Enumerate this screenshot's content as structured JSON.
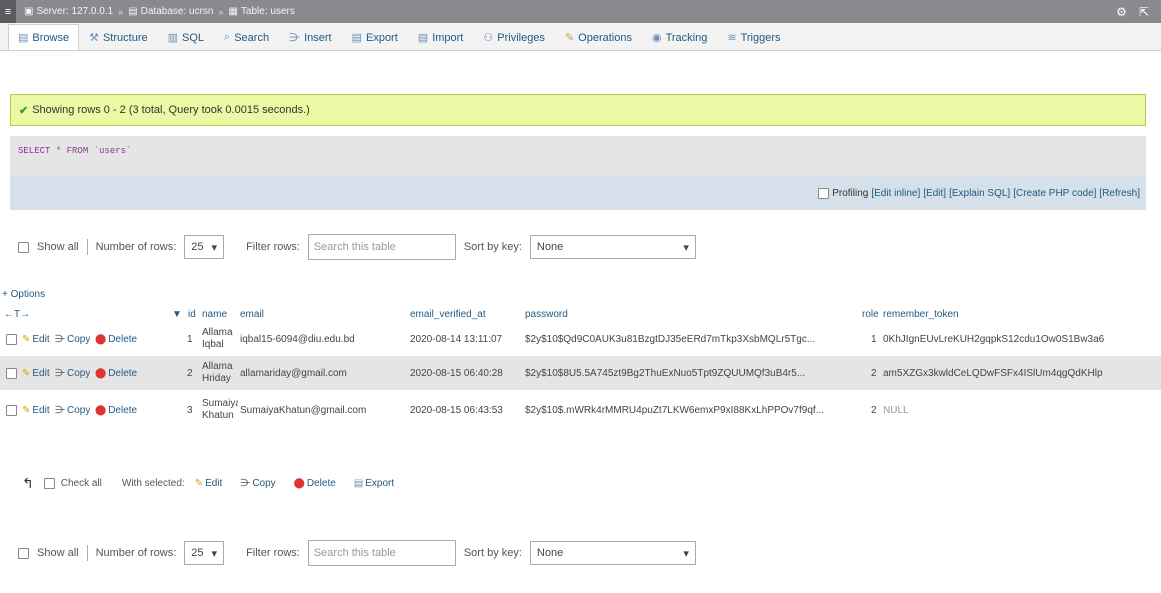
{
  "breadcrumb": {
    "server": "Server: 127.0.0.1",
    "database": "Database: ucrsn",
    "table": "Table: users"
  },
  "tabs": [
    {
      "label": "Browse",
      "icon": "browse-icon"
    },
    {
      "label": "Structure",
      "icon": "structure-icon"
    },
    {
      "label": "SQL",
      "icon": "sql-icon"
    },
    {
      "label": "Search",
      "icon": "search-icon"
    },
    {
      "label": "Insert",
      "icon": "insert-icon"
    },
    {
      "label": "Export",
      "icon": "export-icon"
    },
    {
      "label": "Import",
      "icon": "import-icon"
    },
    {
      "label": "Privileges",
      "icon": "privileges-icon"
    },
    {
      "label": "Operations",
      "icon": "operations-icon"
    },
    {
      "label": "Tracking",
      "icon": "tracking-icon"
    },
    {
      "label": "Triggers",
      "icon": "triggers-icon"
    }
  ],
  "message": "Showing rows 0 - 2 (3 total, Query took 0.0015 seconds.)",
  "sql": {
    "select": "SELECT",
    "rest": "* FROM `users`"
  },
  "sql_links": {
    "profiling": "Profiling",
    "edit_inline": "[Edit inline]",
    "edit": "[Edit]",
    "explain": "[Explain SQL]",
    "create_php": "[Create PHP code]",
    "refresh": "[Refresh]"
  },
  "nav": {
    "show_all": "Show all",
    "number_of_rows": "Number of rows:",
    "rows_value": "25",
    "filter_rows": "Filter rows:",
    "filter_placeholder": "Search this table",
    "sort_by_key": "Sort by key:",
    "sort_value": "None"
  },
  "options": "+ Options",
  "columns": [
    "id",
    "name",
    "email",
    "email_verified_at",
    "password",
    "role",
    "remember_token"
  ],
  "actions": {
    "edit": "Edit",
    "copy": "Copy",
    "delete": "Delete"
  },
  "rows": [
    {
      "id": "1",
      "name": "Allama Iqbal",
      "email": "iqbal15-6094@diu.edu.bd",
      "email_verified_at": "2020-08-14 13:11:07",
      "password": "$2y$10$Qd9C0AUK3u81BzgtDJ35eERd7mTkp3XsbMQLr5Tgc...",
      "role": "1",
      "remember_token": "0KhJIgnEUvLreKUH2gqpkS12cdu1Ow0S1Bw3a6"
    },
    {
      "id": "2",
      "name": "Allama Hriday",
      "email": "allamariday@gmail.com",
      "email_verified_at": "2020-08-15 06:40:28",
      "password": "$2y$10$8U5.5A745zt9Bg2ThuExNuo5Tpt9ZQUUMQf3uB4r5...",
      "role": "2",
      "remember_token": "am5XZGx3kwldCeLQDwFSFx4ISlUm4qgQdKHlp"
    },
    {
      "id": "3",
      "name": "Sumaiya Khatun",
      "email": "SumaiyaKhatun@gmail.com",
      "email_verified_at": "2020-08-15 06:43:53",
      "password": "$2y$10$.mWRk4rMMRU4puZt7LKW6emxP9xI88KxLhPPOv7f9qf...",
      "role": "2",
      "remember_token": "NULL"
    }
  ],
  "bulk": {
    "check_all": "Check all",
    "with_selected": "With selected:",
    "edit": "Edit",
    "copy": "Copy",
    "delete": "Delete",
    "export": "Export"
  }
}
